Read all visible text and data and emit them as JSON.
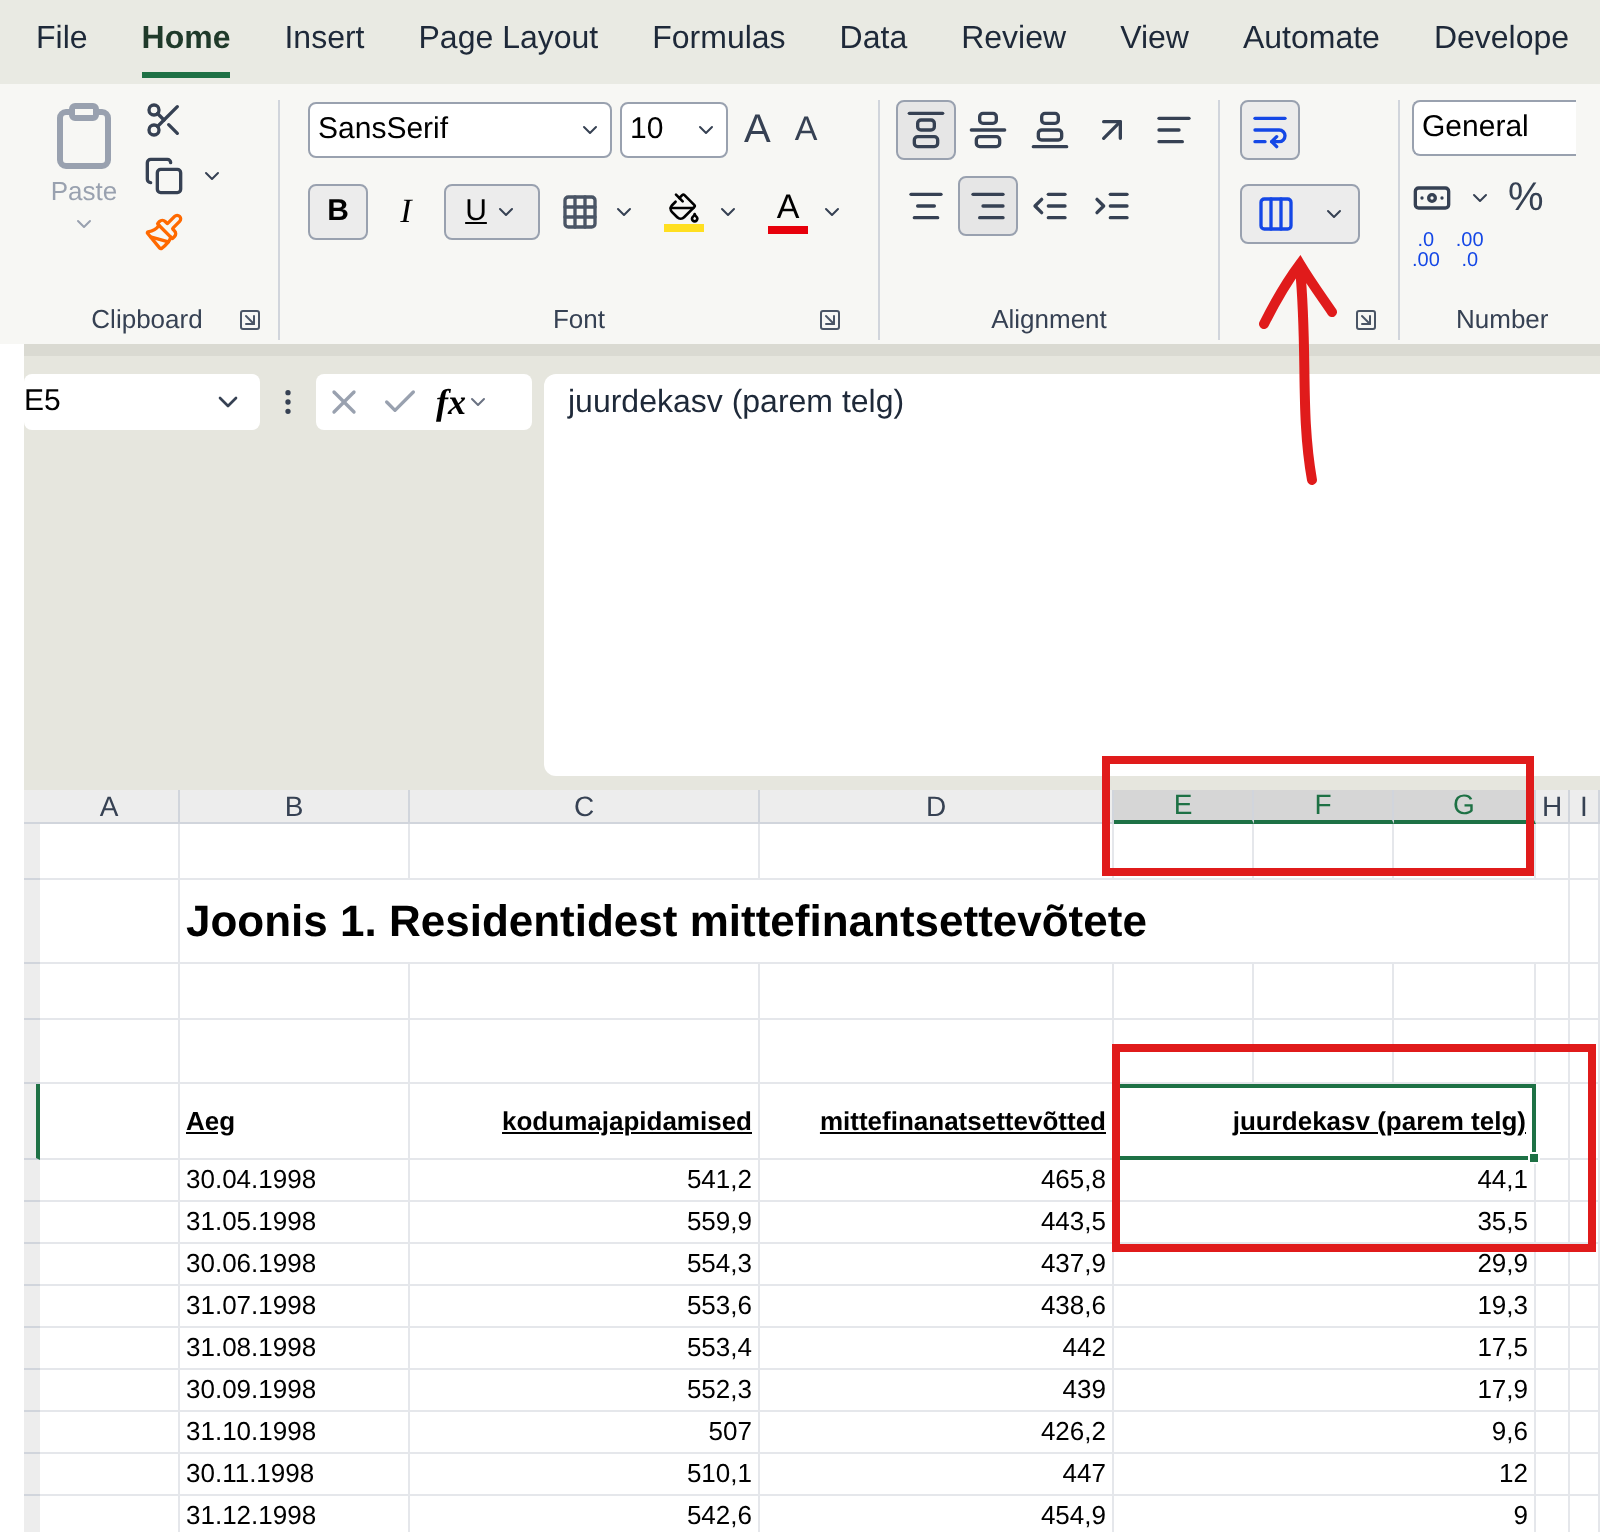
{
  "menu_tabs": [
    {
      "label": "File",
      "selected": false
    },
    {
      "label": "Home",
      "selected": true
    },
    {
      "label": "Insert",
      "selected": false
    },
    {
      "label": "Page Layout",
      "selected": false
    },
    {
      "label": "Formulas",
      "selected": false
    },
    {
      "label": "Data",
      "selected": false
    },
    {
      "label": "Review",
      "selected": false
    },
    {
      "label": "View",
      "selected": false
    },
    {
      "label": "Automate",
      "selected": false
    },
    {
      "label": "Develope",
      "selected": false
    }
  ],
  "ribbon": {
    "clipboard": {
      "paste_label": "Paste",
      "label": "Clipboard"
    },
    "font": {
      "font_name": "SansSerif",
      "font_size": "10",
      "grow_label": "A",
      "shrink_label": "A",
      "bold_label": "B",
      "italic_label": "I",
      "underline_label": "U",
      "underline_pressed": true,
      "color_label": "A",
      "label": "Font"
    },
    "alignment": {
      "label": "Alignment",
      "buttons": [
        {
          "kind": "top",
          "pressed": true
        },
        {
          "kind": "middle",
          "pressed": false
        },
        {
          "kind": "bottom",
          "pressed": false
        },
        {
          "kind": "orientation",
          "pressed": false
        },
        {
          "kind": "left",
          "pressed": false
        },
        {
          "kind": "center",
          "pressed": false
        },
        {
          "kind": "right",
          "pressed": true
        },
        {
          "kind": "outdent",
          "pressed": false
        },
        {
          "kind": "indent",
          "pressed": false
        }
      ],
      "merge_pressed": true
    },
    "number": {
      "format": "General",
      "percent_label": "%",
      "increase_decimal": [
        ".0",
        ".00"
      ],
      "decrease_decimal": [
        ".00",
        ".0"
      ],
      "label": "Number"
    }
  },
  "formula_bar": {
    "name_box": "E5",
    "fx_label": "fx",
    "content": "juurdekasv (parem telg)"
  },
  "sheet": {
    "columns": [
      {
        "label": "A",
        "selected": false
      },
      {
        "label": "B",
        "selected": false
      },
      {
        "label": "C",
        "selected": false
      },
      {
        "label": "D",
        "selected": false
      },
      {
        "label": "E",
        "selected": true
      },
      {
        "label": "F",
        "selected": true
      },
      {
        "label": "G",
        "selected": true
      },
      {
        "label": "H",
        "selected": false
      },
      {
        "label": "I",
        "selected": false
      }
    ],
    "title": "Joonis 1. Residentidest mittefinantsettevõtete",
    "headers": [
      {
        "selected": false
      },
      {
        "text": "Aeg",
        "selected": false
      },
      {
        "text": "kodumajapidamised",
        "selected": false
      },
      {
        "text": "mittefinanatsettevõtted",
        "selected": false
      },
      {
        "text": "juurdekasv (parem telg)",
        "selected": true
      }
    ],
    "rows": [
      [
        "",
        "30.04.1998",
        "541,2",
        "465,8",
        "44,1"
      ],
      [
        "",
        "31.05.1998",
        "559,9",
        "443,5",
        "35,5"
      ],
      [
        "",
        "30.06.1998",
        "554,3",
        "437,9",
        "29,9"
      ],
      [
        "",
        "31.07.1998",
        "553,6",
        "438,6",
        "19,3"
      ],
      [
        "",
        "31.08.1998",
        "553,4",
        "442",
        "17,5"
      ],
      [
        "",
        "30.09.1998",
        "552,3",
        "439",
        "17,9"
      ],
      [
        "",
        "31.10.1998",
        "507",
        "426,2",
        "9,6"
      ],
      [
        "",
        "30.11.1998",
        "510,1",
        "447",
        "12"
      ],
      [
        "",
        "31.12.1998",
        "542,6",
        "454,9",
        "9"
      ]
    ]
  }
}
